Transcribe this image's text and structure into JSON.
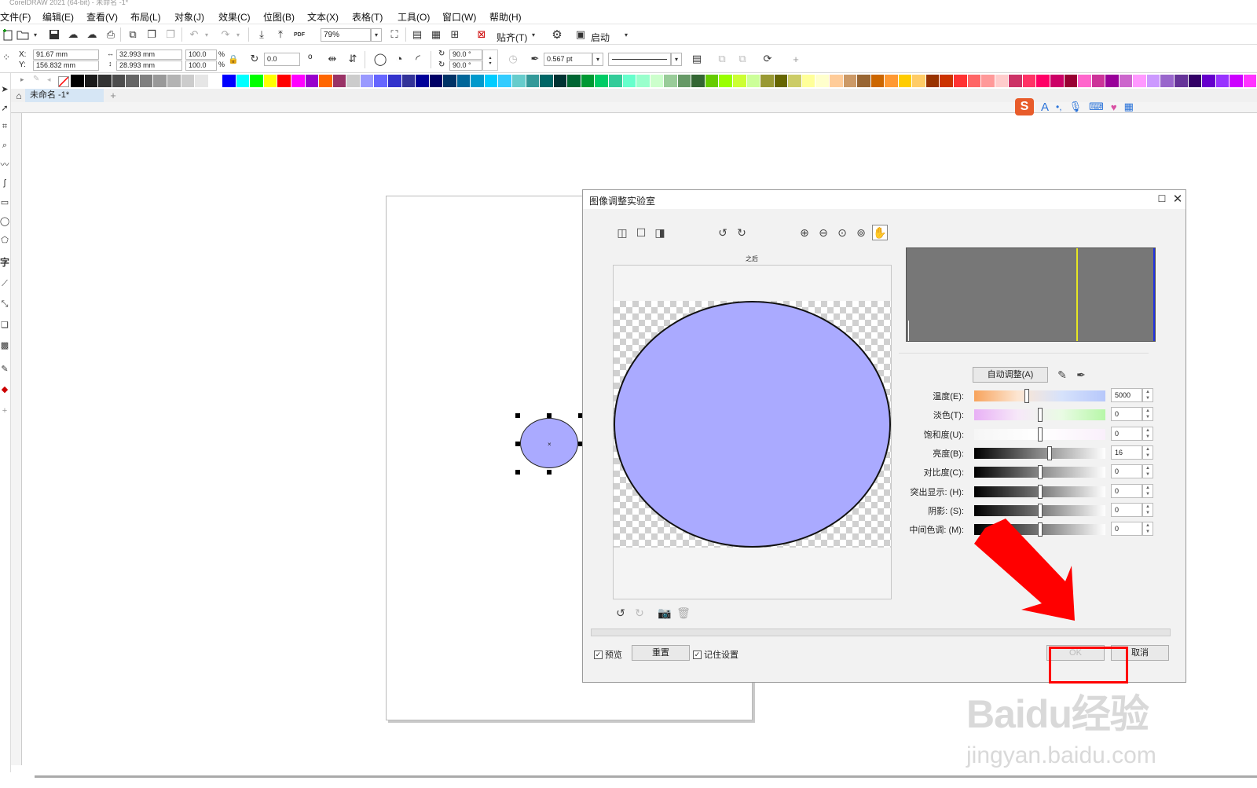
{
  "app": {
    "title": "CorelDRAW 2021 (64-bit) - 未命名 -1*"
  },
  "menu": [
    "文件(F)",
    "编辑(E)",
    "查看(V)",
    "布局(L)",
    "对象(J)",
    "效果(C)",
    "位图(B)",
    "文本(X)",
    "表格(T)",
    "工具(O)",
    "窗口(W)",
    "帮助(H)"
  ],
  "toolbar": {
    "zoom": "79%",
    "snap_label": "贴齐(T)",
    "launch_label": "启动",
    "pdf_label": "PDF"
  },
  "props": {
    "x_label": "X:",
    "y_label": "Y:",
    "x": "91.67 mm",
    "y": "156.832 mm",
    "w": "32.993 mm",
    "h": "28.993 mm",
    "sx": "100.0",
    "sy": "100.0",
    "pct": "%",
    "rotation": "0.0",
    "deg_symbol": "o",
    "angle1": "90.0 °",
    "angle2": "90.0 °",
    "outline": "0.567 pt"
  },
  "tabs": {
    "doc": "未命名 -1*"
  },
  "colors": {
    "palette": [
      "#000000",
      "#1a1a1a",
      "#333333",
      "#4d4d4d",
      "#666666",
      "#808080",
      "#999999",
      "#b3b3b3",
      "#cccccc",
      "#e6e6e6",
      "#ffffff",
      "#0000ff",
      "#00ffff",
      "#00ff00",
      "#ffff00",
      "#ff0000",
      "#ff00ff",
      "#9900cc",
      "#ff6600",
      "#993366",
      "#cccccc",
      "#9999ff",
      "#6666ff",
      "#3333cc",
      "#333399",
      "#000099",
      "#000066",
      "#003366",
      "#006699",
      "#0099cc",
      "#00ccff",
      "#33ccff",
      "#66cccc",
      "#339999",
      "#006666",
      "#003333",
      "#006633",
      "#009933",
      "#00cc66",
      "#33cc99",
      "#66ffcc",
      "#99ffcc",
      "#ccffcc",
      "#99cc99",
      "#669966",
      "#336633",
      "#66cc00",
      "#99ff00",
      "#ccff33",
      "#ccff99",
      "#999933",
      "#666600",
      "#cccc66",
      "#ffff99",
      "#ffffcc",
      "#ffcc99",
      "#cc9966",
      "#996633",
      "#cc6600",
      "#ff9933",
      "#ffcc00",
      "#ffcc66",
      "#993300",
      "#cc3300",
      "#ff3333",
      "#ff6666",
      "#ff9999",
      "#ffcccc",
      "#cc3366",
      "#ff3366",
      "#ff0066",
      "#cc0066",
      "#990033",
      "#ff66cc",
      "#cc3399",
      "#990099",
      "#cc66cc",
      "#ff99ff",
      "#cc99ff",
      "#9966cc",
      "#663399",
      "#330066",
      "#6600cc",
      "#9933ff",
      "#cc00ff",
      "#ff33ff"
    ],
    "ellipse_fill": "#aaaaff",
    "accent_red": "#ff0000"
  },
  "dialog": {
    "title": "图像调整实验室",
    "after_label": "之后",
    "auto_adjust": "自动调整(A)",
    "sliders": [
      {
        "label": "温度(E):",
        "value": "5000",
        "pos": 0.4
      },
      {
        "label": "淡色(T):",
        "value": "0",
        "pos": 0.5
      },
      {
        "label": "饱和度(U):",
        "value": "0",
        "pos": 0.5
      },
      {
        "label": "亮度(B):",
        "value": "16",
        "pos": 0.58
      },
      {
        "label": "对比度(C):",
        "value": "0",
        "pos": 0.5
      },
      {
        "label": "突出显示: (H):",
        "value": "0",
        "pos": 0.5
      },
      {
        "label": "阴影: (S):",
        "value": "0",
        "pos": 0.5
      },
      {
        "label": "中间色调: (M):",
        "value": "0",
        "pos": 0.5
      }
    ],
    "preview_label": "预览",
    "reset_label": "重置",
    "remember_label": "记住设置",
    "ok_label": "OK",
    "cancel_label": "取消"
  },
  "watermark": {
    "line1": "Baidu经验",
    "line2": "jingyan.baidu.com"
  }
}
